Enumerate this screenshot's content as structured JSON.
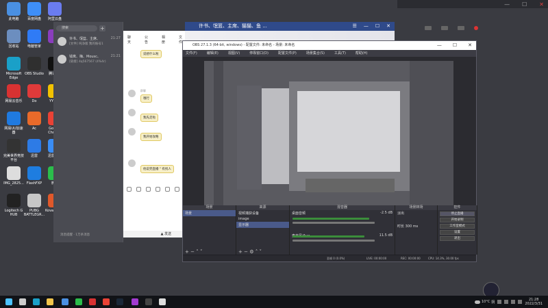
{
  "desktop": {
    "icons": [
      {
        "label": "此电脑",
        "color": "#4a90e2"
      },
      {
        "label": "百度网盘",
        "color": "#3e8ef7"
      },
      {
        "label": "阿里云盘",
        "color": "#6a7cf0"
      },
      {
        "label": "回收站",
        "color": "#6c8ebf"
      },
      {
        "label": "电脑管家",
        "color": "#2f7bf6"
      },
      {
        "label": "Pr",
        "color": "#8a3dbd"
      },
      {
        "label": "Microsoft Edge",
        "color": "#1aa0c8"
      },
      {
        "label": "OBS Studio",
        "color": "#2f2f2f"
      },
      {
        "label": "腾讯QQ",
        "color": "#111111"
      },
      {
        "label": "网易云音乐",
        "color": "#d83232"
      },
      {
        "label": "Do",
        "color": "#e03a3a"
      },
      {
        "label": "YY语音",
        "color": "#f2c200"
      },
      {
        "label": "网易UU加速器",
        "color": "#1f7ae0"
      },
      {
        "label": "Ac",
        "color": "#e86a2a"
      },
      {
        "label": "Google Chrome",
        "color": "#e94235"
      },
      {
        "label": "完美世界竞技平台",
        "color": "#333333"
      },
      {
        "label": "迅雷",
        "color": "#2d7be6"
      },
      {
        "label": "迅雷影音",
        "color": "#3a8df5"
      },
      {
        "label": "IMG_2825...",
        "color": "#dddddd"
      },
      {
        "label": "FlashFXP",
        "color": "#1e7de0"
      },
      {
        "label": "微信",
        "color": "#2bbd4b"
      },
      {
        "label": "Logitech G HUB",
        "color": "#222222"
      },
      {
        "label": "PUBG BATTLEGR...",
        "color": "#c7c7c7"
      },
      {
        "label": "KovaaK 2.0",
        "color": "#e0582a"
      }
    ]
  },
  "chat": {
    "search_placeholder": "搜索",
    "plus": "+",
    "conversations": [
      {
        "name": "许书、氓篮、主席、",
        "time": "21:27",
        "preview": "[文件] 纯净版 我的账号1"
      },
      {
        "name": "钱离、梅、Mousc、",
        "time": "21:21",
        "preview": "[链接] 4q567567 (4%4r)"
      }
    ],
    "footer": "消息提醒  ·  1万条消息",
    "tabs": [
      "聊天",
      "公告",
      "相册",
      "文件"
    ],
    "messages": [
      {
        "sender": "群聊",
        "text": "说想什么啦"
      },
      {
        "sender": "群聊",
        "text": "哦行"
      },
      {
        "sender": "群聊",
        "text": "我先走啦"
      },
      {
        "sender": "群聊",
        "text": "我开始攻略"
      },
      {
        "sender": "群聊",
        "text": "他说完直播 \" 有找人"
      }
    ],
    "send_label": "▲ 发送",
    "window_title": "许书、氓篮、主席、猫猫、鱼 ...",
    "window_buttons": [
      "☰",
      "—",
      "☐",
      "✕"
    ]
  },
  "obs": {
    "title": "OBS 27.1.3 (64-bit, windows) - 配置文件: 未命名 - 场景: 未命名",
    "window_buttons": [
      "—",
      "☐",
      "✕"
    ],
    "menu": [
      "文件(F)",
      "编辑(E)",
      "视图(V)",
      "停靠窗口(D)",
      "配置文件(P)",
      "场景集合(S)",
      "工具(T)",
      "帮助(H)"
    ],
    "docks": {
      "scenes": {
        "header": "场景",
        "items": [
          "场景"
        ]
      },
      "sources": {
        "header": "来源",
        "items": [
          "视频捕获设备",
          "image",
          "显示器"
        ]
      },
      "mixer": {
        "header": "混音器",
        "channels": [
          {
            "name": "桌面音频",
            "db": "-2.5 dB",
            "level": 0.8
          },
          {
            "name": "麦克风/Aux",
            "db": "11.5 dB",
            "level": 0.75
          }
        ]
      },
      "transitions": {
        "header": "场景转场",
        "mode": "淡出",
        "duration_label": "时长",
        "duration": "300 ms"
      },
      "controls": {
        "header": "控件",
        "buttons": [
          "停止直播",
          "开始录制",
          "工作室模式",
          "设置",
          "退出"
        ]
      }
    },
    "status": {
      "dropped": "丢帧 0 (0.0%)",
      "live": "LIVE: 00:00:00",
      "rec": "REC: 00:00:00",
      "cpu": "CPU: 14.3%, 30.00 fps"
    }
  },
  "taskbar": {
    "apps": [
      {
        "name": "start",
        "color": "#4cc2ff"
      },
      {
        "name": "search",
        "color": "#cccccc"
      },
      {
        "name": "edge",
        "color": "#1aa0c8"
      },
      {
        "name": "file-explorer",
        "color": "#f2c54b"
      },
      {
        "name": "qq",
        "color": "#4a90e2"
      },
      {
        "name": "wechat",
        "color": "#2bbd4b"
      },
      {
        "name": "netease-music",
        "color": "#d83232"
      },
      {
        "name": "chrome",
        "color": "#e94235"
      },
      {
        "name": "steam",
        "color": "#1b2838"
      },
      {
        "name": "yy",
        "color": "#a33ad0"
      },
      {
        "name": "terminal",
        "color": "#444444"
      },
      {
        "name": "obs",
        "color": "#dddddd"
      }
    ],
    "temperature": "10°C",
    "weather": "阴",
    "time": "21:28",
    "date": "2022/3/31"
  },
  "accent_colors": {
    "qq_blue": "#2f4a8a",
    "obs_selected": "#4a5a8a",
    "bubble": "#f7efc8"
  }
}
